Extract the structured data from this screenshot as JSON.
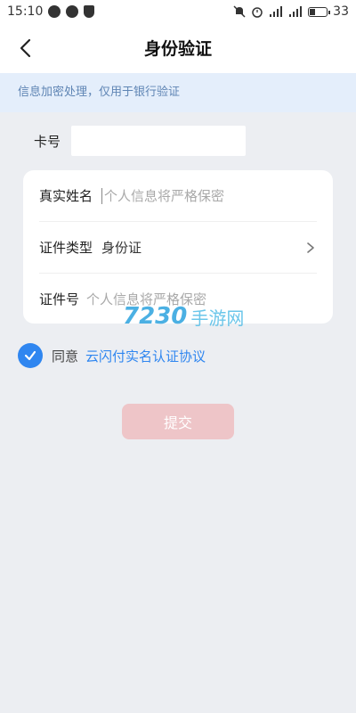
{
  "status_bar": {
    "time": "15:10",
    "battery": "33",
    "icons": [
      "chat-icon",
      "message-icon",
      "shield-icon",
      "mute-icon",
      "alarm-icon",
      "signal-4g-icon",
      "signal-icon",
      "battery-icon"
    ]
  },
  "nav": {
    "title": "身份验证",
    "back_icon": "chevron-left-icon"
  },
  "notice": {
    "text": "信息加密处理，仅用于银行验证"
  },
  "card": {
    "label": "卡号",
    "value": ""
  },
  "form": {
    "name_label": "真实姓名",
    "name_placeholder": "个人信息将严格保密",
    "id_type_label": "证件类型",
    "id_type_value": "身份证",
    "id_no_label": "证件号",
    "id_no_placeholder": "个人信息将严格保密"
  },
  "agreement": {
    "checked": true,
    "prefix": "同意",
    "link_text": "云闪付实名认证协议"
  },
  "submit_label": "提交",
  "watermark": {
    "number": "7230",
    "text": "手游网"
  },
  "colors": {
    "accent": "#2f86f0",
    "submit_disabled": "#eec5c8",
    "notice_bg": "#e4eefb",
    "notice_text": "#5f85b4",
    "page_bg": "#eceef2"
  }
}
